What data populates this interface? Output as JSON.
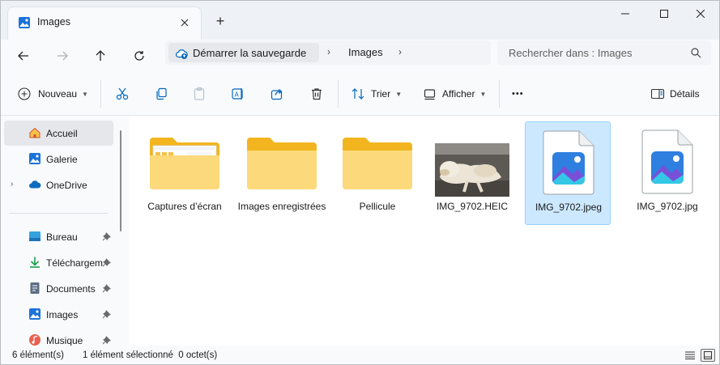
{
  "window": {
    "tab_title": "Images",
    "tab_close_icon": "close-icon",
    "new_tab_symbol": "+"
  },
  "address": {
    "home_label": "Démarrer la sauvegarde",
    "current": "Images",
    "search_placeholder": "Rechercher dans : Images"
  },
  "commands": {
    "new_label": "Nouveau",
    "sort_label": "Trier",
    "view_label": "Afficher",
    "more_label": "•••",
    "details_label": "Détails"
  },
  "sidebar": {
    "items": [
      {
        "label": "Accueil",
        "icon": "home-icon"
      },
      {
        "label": "Galerie",
        "icon": "gallery-icon"
      },
      {
        "label": "OneDrive",
        "icon": "cloud-icon"
      },
      {
        "label": "Bureau",
        "icon": "desktop-icon"
      },
      {
        "label": "Téléchargements",
        "icon": "download-icon"
      },
      {
        "label": "Documents",
        "icon": "document-icon"
      },
      {
        "label": "Images",
        "icon": "pictures-icon"
      },
      {
        "label": "Musique",
        "icon": "music-icon"
      }
    ]
  },
  "files": [
    {
      "name": "Captures d’écran",
      "type": "folder-with-preview"
    },
    {
      "name": "Images enregistrées",
      "type": "folder"
    },
    {
      "name": "Pellicule",
      "type": "folder"
    },
    {
      "name": "IMG_9702.HEIC",
      "type": "photo"
    },
    {
      "name": "IMG_9702.jpeg",
      "type": "image-file",
      "selected": true
    },
    {
      "name": "IMG_9702.jpg",
      "type": "image-file"
    }
  ],
  "status": {
    "count": "6 élément(s)",
    "selection": "1 élément sélectionné  0 octet(s)"
  },
  "colors": {
    "accent": "#0067c0",
    "selection_bg": "#cce8ff",
    "folder": "#f8c33a"
  }
}
